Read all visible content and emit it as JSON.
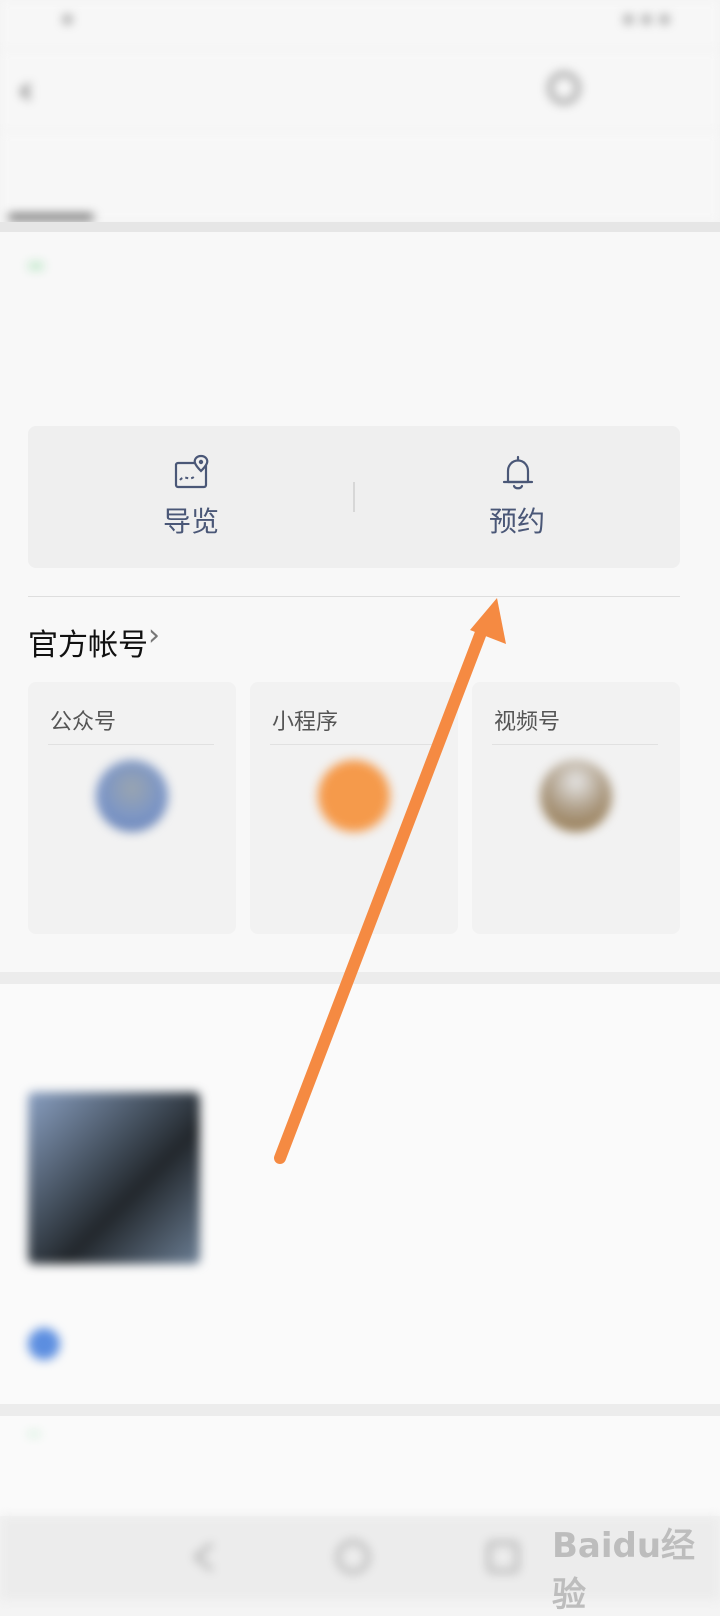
{
  "status_bar": {
    "left_text": "*",
    "right_text": "* * *"
  },
  "header": {
    "title": "",
    "action_label": ""
  },
  "tabs": [
    {
      "label": ""
    },
    {
      "label": ""
    },
    {
      "label": ""
    },
    {
      "label": ""
    },
    {
      "label": ""
    },
    {
      "label": ""
    }
  ],
  "place": {
    "name": "",
    "tag": "",
    "address": "",
    "phone": "",
    "hours": ""
  },
  "actions": [
    {
      "label": "导览",
      "icon": "map-pin-icon"
    },
    {
      "label": "预约",
      "icon": "bell-icon"
    }
  ],
  "official_accounts": {
    "title": "官方帐号",
    "cards": [
      {
        "label": "公众号",
        "name": "",
        "avatar_color": "#7b95c6"
      },
      {
        "label": "小程序",
        "name": "",
        "avatar_color": "#f59a4b"
      },
      {
        "label": "视频号",
        "name": "",
        "avatar_color": "#8a7050"
      }
    ]
  },
  "nearby": {
    "title": "",
    "item_name": "",
    "line1": "",
    "line2": "",
    "tag": "",
    "info_text": ""
  },
  "bottom": {
    "title_highlight": "",
    "title_rest": "",
    "subtitle": ""
  },
  "watermark": {
    "text": "Baidu经验"
  },
  "colors": {
    "arrow": "#f58a42",
    "link_blue": "#3d57a8",
    "green": "#36b45a"
  }
}
